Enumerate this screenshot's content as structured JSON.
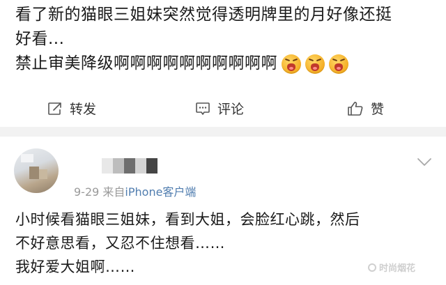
{
  "post": {
    "text_lines": [
      "看了新的猫眼三姐妹突然觉得透明牌里的月好像还挺",
      "好看...",
      "禁止审美降级啊啊啊啊啊啊啊啊啊啊"
    ],
    "emojis": [
      "crying-face-icon",
      "crying-face-icon",
      "crying-face-icon"
    ]
  },
  "actions": {
    "repost_label": "转发",
    "comment_label": "评论",
    "like_label": "赞"
  },
  "comment": {
    "date": "9-29",
    "source_prefix": "来自",
    "source": "iPhone客户端",
    "text_lines": [
      "小时候看猫眼三姐妹，看到大姐，会脸红心跳，然后",
      "不好意思看，又忍不住想看……",
      "我好爱大姐啊……"
    ]
  },
  "watermark": "时尚烟花",
  "colors": {
    "link": "#507daf",
    "meta": "#9a9a9a",
    "divider": "#f2f2f2"
  }
}
